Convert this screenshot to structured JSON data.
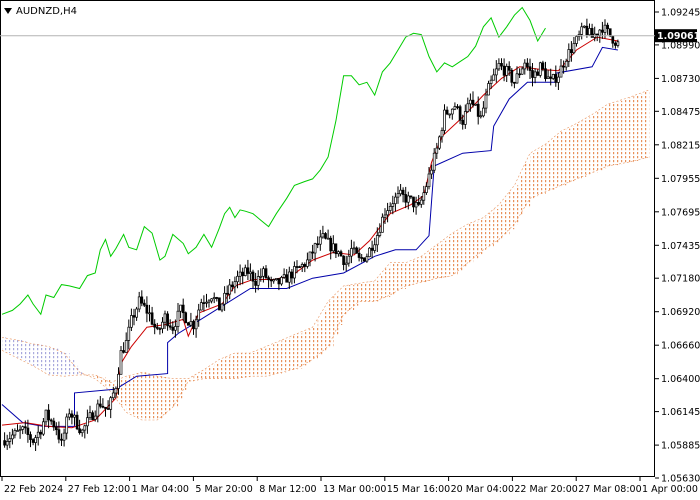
{
  "chart_data": {
    "type": "candlestick",
    "symbol_label": "AUDNZD,H4",
    "current_price": "1.09061",
    "x_tick_labels": [
      "22 Feb 2024",
      "27 Feb 12:00",
      "1 Mar 04:00",
      "5 Mar 20:00",
      "8 Mar 12:00",
      "13 Mar 00:00",
      "15 Mar 16:00",
      "20 Mar 04:00",
      "22 Mar 20:00",
      "27 Mar 08:00",
      "1 Apr 00:00"
    ],
    "y_tick_labels": [
      "1.09245",
      "1.08990",
      "1.08730",
      "1.08475",
      "1.08215",
      "1.07955",
      "1.07695",
      "1.07435",
      "1.07180",
      "1.06920",
      "1.06660",
      "1.06400",
      "1.06145",
      "1.05885",
      "1.05630"
    ],
    "ylim": [
      1.0563,
      1.09245
    ],
    "colors": {
      "candles": "#000000",
      "tenkan": "#cc0000",
      "kijun": "#0000aa",
      "chikou": "#00cc00",
      "cloud": "#e8915a",
      "cloud_bear": "#a8a8dc",
      "price_line": "#b4b4b4",
      "price_box": "#000000"
    },
    "close_path": [
      [
        0,
        1.0592
      ],
      [
        4,
        1.0596
      ],
      [
        8,
        1.06
      ],
      [
        12,
        1.0592
      ],
      [
        15,
        1.0601
      ],
      [
        17,
        1.0612
      ],
      [
        21,
        1.0602
      ],
      [
        23,
        1.0589
      ],
      [
        26,
        1.0615
      ],
      [
        29,
        1.0605
      ],
      [
        31,
        1.0599
      ],
      [
        34,
        1.061
      ],
      [
        38,
        1.0621
      ],
      [
        41,
        1.0615
      ],
      [
        44,
        1.0635
      ],
      [
        46,
        1.066
      ],
      [
        48,
        1.0668
      ],
      [
        50,
        1.0685
      ],
      [
        53,
        1.07
      ],
      [
        57,
        1.069
      ],
      [
        60,
        1.0675
      ],
      [
        63,
        1.0688
      ],
      [
        66,
        1.068
      ],
      [
        69,
        1.0693
      ],
      [
        72,
        1.0685
      ],
      [
        74,
        1.0682
      ],
      [
        77,
        1.07
      ],
      [
        81,
        1.0705
      ],
      [
        84,
        1.0695
      ],
      [
        88,
        1.071
      ],
      [
        91,
        1.0718
      ],
      [
        95,
        1.0723
      ],
      [
        98,
        1.0716
      ],
      [
        101,
        1.0722
      ],
      [
        104,
        1.0713
      ],
      [
        108,
        1.0715
      ],
      [
        111,
        1.072
      ],
      [
        115,
        1.0726
      ],
      [
        118,
        1.0731
      ],
      [
        121,
        1.0742
      ],
      [
        124,
        1.0749
      ],
      [
        127,
        1.0743
      ],
      [
        130,
        1.0738
      ],
      [
        133,
        1.073
      ],
      [
        135,
        1.074
      ],
      [
        138,
        1.0732
      ],
      [
        141,
        1.0736
      ],
      [
        145,
        1.0752
      ],
      [
        148,
        1.077
      ],
      [
        151,
        1.0778
      ],
      [
        154,
        1.0782
      ],
      [
        158,
        1.0778
      ],
      [
        161,
        1.0772
      ],
      [
        164,
        1.079
      ],
      [
        168,
        1.0818
      ],
      [
        171,
        1.0845
      ],
      [
        175,
        1.0852
      ],
      [
        178,
        1.084
      ],
      [
        181,
        1.0855
      ],
      [
        185,
        1.0842
      ],
      [
        188,
        1.0865
      ],
      [
        192,
        1.0883
      ],
      [
        195,
        1.0878
      ],
      [
        198,
        1.087
      ],
      [
        202,
        1.0886
      ],
      [
        205,
        1.0874
      ],
      [
        208,
        1.0882
      ],
      [
        212,
        1.087
      ],
      [
        215,
        1.0876
      ],
      [
        218,
        1.089
      ],
      [
        222,
        1.0902
      ],
      [
        225,
        1.0912
      ],
      [
        228,
        1.0905
      ],
      [
        232,
        1.0913
      ],
      [
        236,
        1.0904
      ],
      [
        238,
        1.09
      ]
    ],
    "tenkan": [
      [
        0,
        1.0604
      ],
      [
        9,
        1.0606
      ],
      [
        18,
        1.0603
      ],
      [
        27,
        1.0602
      ],
      [
        36,
        1.0608
      ],
      [
        44,
        1.0625
      ],
      [
        46,
        1.0652
      ],
      [
        50,
        1.0665
      ],
      [
        56,
        1.068
      ],
      [
        63,
        1.0682
      ],
      [
        70,
        1.0686
      ],
      [
        72,
        1.0673
      ],
      [
        76,
        1.0691
      ],
      [
        85,
        1.0698
      ],
      [
        90,
        1.0712
      ],
      [
        97,
        1.0717
      ],
      [
        105,
        1.0717
      ],
      [
        112,
        1.072
      ],
      [
        120,
        1.0732
      ],
      [
        128,
        1.0738
      ],
      [
        136,
        1.0736
      ],
      [
        142,
        1.0747
      ],
      [
        150,
        1.0768
      ],
      [
        158,
        1.0775
      ],
      [
        163,
        1.0782
      ],
      [
        166,
        1.0808
      ],
      [
        170,
        1.0828
      ],
      [
        178,
        1.0843
      ],
      [
        186,
        1.086
      ],
      [
        193,
        1.0873
      ],
      [
        200,
        1.0882
      ],
      [
        208,
        1.088
      ],
      [
        215,
        1.0879
      ],
      [
        222,
        1.0895
      ],
      [
        230,
        1.0905
      ],
      [
        238,
        1.0902
      ]
    ],
    "kijun": [
      [
        0,
        1.062
      ],
      [
        8,
        1.0606
      ],
      [
        16,
        1.0603
      ],
      [
        28,
        1.0603
      ],
      [
        28,
        1.0629
      ],
      [
        44,
        1.0632
      ],
      [
        52,
        1.0642
      ],
      [
        64,
        1.0644
      ],
      [
        64,
        1.0668
      ],
      [
        68,
        1.0675
      ],
      [
        80,
        1.069
      ],
      [
        96,
        1.071
      ],
      [
        110,
        1.071
      ],
      [
        120,
        1.0718
      ],
      [
        132,
        1.0722
      ],
      [
        144,
        1.0735
      ],
      [
        152,
        1.074
      ],
      [
        160,
        1.074
      ],
      [
        165,
        1.0751
      ],
      [
        167,
        1.0805
      ],
      [
        178,
        1.0815
      ],
      [
        189,
        1.0817
      ],
      [
        190,
        1.0836
      ],
      [
        196,
        1.0857
      ],
      [
        203,
        1.087
      ],
      [
        214,
        1.087
      ],
      [
        214,
        1.0877
      ],
      [
        228,
        1.0882
      ],
      [
        232,
        1.0897
      ],
      [
        238,
        1.0895
      ]
    ],
    "chikou": [
      [
        0,
        1.069
      ],
      [
        4,
        1.0693
      ],
      [
        7,
        1.0698
      ],
      [
        10,
        1.0705
      ],
      [
        12,
        1.0698
      ],
      [
        15,
        1.069
      ],
      [
        17,
        1.0705
      ],
      [
        20,
        1.0703
      ],
      [
        23,
        1.0713
      ],
      [
        26,
        1.0712
      ],
      [
        30,
        1.071
      ],
      [
        33,
        1.072
      ],
      [
        36,
        1.0722
      ],
      [
        38,
        1.074
      ],
      [
        40,
        1.0748
      ],
      [
        42,
        1.0735
      ],
      [
        44,
        1.0741
      ],
      [
        47,
        1.0752
      ],
      [
        49,
        1.0742
      ],
      [
        52,
        1.074
      ],
      [
        55,
        1.0758
      ],
      [
        58,
        1.0753
      ],
      [
        61,
        1.0732
      ],
      [
        63,
        1.0735
      ],
      [
        66,
        1.0752
      ],
      [
        70,
        1.0745
      ],
      [
        72,
        1.0737
      ],
      [
        75,
        1.0742
      ],
      [
        78,
        1.0752
      ],
      [
        81,
        1.0742
      ],
      [
        84,
        1.0757
      ],
      [
        86,
        1.0768
      ],
      [
        88,
        1.0773
      ],
      [
        90,
        1.0765
      ],
      [
        92,
        1.0771
      ],
      [
        94,
        1.077
      ],
      [
        97,
        1.0768
      ],
      [
        100,
        1.0763
      ],
      [
        103,
        1.0758
      ],
      [
        106,
        1.0768
      ],
      [
        110,
        1.078
      ],
      [
        113,
        1.079
      ],
      [
        117,
        1.0793
      ],
      [
        120,
        1.0795
      ],
      [
        123,
        1.0802
      ],
      [
        126,
        1.0812
      ],
      [
        129,
        1.084
      ],
      [
        132,
        1.0875
      ],
      [
        135,
        1.0875
      ],
      [
        138,
        1.0868
      ],
      [
        141,
        1.087
      ],
      [
        144,
        1.086
      ],
      [
        147,
        1.0878
      ],
      [
        150,
        1.0885
      ],
      [
        153,
        1.0895
      ],
      [
        156,
        1.0905
      ],
      [
        159,
        1.0908
      ],
      [
        162,
        1.0907
      ],
      [
        165,
        1.089
      ],
      [
        168,
        1.0878
      ],
      [
        171,
        1.0885
      ],
      [
        174,
        1.0882
      ],
      [
        177,
        1.0886
      ],
      [
        180,
        1.089
      ],
      [
        183,
        1.0898
      ],
      [
        186,
        1.0913
      ],
      [
        189,
        1.092
      ],
      [
        192,
        1.0905
      ],
      [
        195,
        1.0913
      ],
      [
        198,
        1.0922
      ],
      [
        201,
        1.0928
      ],
      [
        204,
        1.0918
      ],
      [
        207,
        1.0902
      ],
      [
        210,
        1.0912
      ]
    ],
    "span_a": [
      [
        0,
        1.0662
      ],
      [
        6,
        1.0656
      ],
      [
        12,
        1.065
      ],
      [
        18,
        1.0643
      ],
      [
        24,
        1.0642
      ],
      [
        30,
        1.0643
      ],
      [
        36,
        1.0643
      ],
      [
        42,
        1.0637
      ],
      [
        48,
        1.0642
      ],
      [
        54,
        1.0645
      ],
      [
        60,
        1.0642
      ],
      [
        66,
        1.064
      ],
      [
        72,
        1.064
      ],
      [
        78,
        1.0647
      ],
      [
        84,
        1.0655
      ],
      [
        90,
        1.066
      ],
      [
        96,
        1.066
      ],
      [
        102,
        1.0665
      ],
      [
        108,
        1.067
      ],
      [
        114,
        1.0675
      ],
      [
        120,
        1.068
      ],
      [
        126,
        1.07
      ],
      [
        132,
        1.0712
      ],
      [
        138,
        1.0714
      ],
      [
        144,
        1.0716
      ],
      [
        150,
        1.073
      ],
      [
        156,
        1.073
      ],
      [
        162,
        1.0735
      ],
      [
        168,
        1.0744
      ],
      [
        174,
        1.0753
      ],
      [
        180,
        1.076
      ],
      [
        186,
        1.0765
      ],
      [
        192,
        1.0775
      ],
      [
        198,
        1.079
      ],
      [
        204,
        1.0815
      ],
      [
        210,
        1.0822
      ],
      [
        216,
        1.0832
      ],
      [
        222,
        1.0838
      ],
      [
        228,
        1.0845
      ],
      [
        234,
        1.0853
      ],
      [
        242,
        1.0858
      ],
      [
        250,
        1.0864
      ]
    ],
    "span_b": [
      [
        0,
        1.0672
      ],
      [
        6,
        1.067
      ],
      [
        12,
        1.0667
      ],
      [
        18,
        1.0665
      ],
      [
        24,
        1.066
      ],
      [
        30,
        1.0645
      ],
      [
        36,
        1.064
      ],
      [
        42,
        1.063
      ],
      [
        48,
        1.0614
      ],
      [
        54,
        1.0608
      ],
      [
        60,
        1.0608
      ],
      [
        66,
        1.0618
      ],
      [
        72,
        1.0638
      ],
      [
        78,
        1.064
      ],
      [
        84,
        1.064
      ],
      [
        90,
        1.064
      ],
      [
        96,
        1.0642
      ],
      [
        102,
        1.0642
      ],
      [
        108,
        1.0645
      ],
      [
        114,
        1.0648
      ],
      [
        120,
        1.0655
      ],
      [
        126,
        1.0665
      ],
      [
        132,
        1.069
      ],
      [
        138,
        1.07
      ],
      [
        144,
        1.07
      ],
      [
        150,
        1.0705
      ],
      [
        156,
        1.0712
      ],
      [
        162,
        1.0715
      ],
      [
        168,
        1.0718
      ],
      [
        174,
        1.072
      ],
      [
        180,
        1.073
      ],
      [
        186,
        1.074
      ],
      [
        192,
        1.0748
      ],
      [
        198,
        1.076
      ],
      [
        204,
        1.078
      ],
      [
        210,
        1.0785
      ],
      [
        216,
        1.079
      ],
      [
        222,
        1.0795
      ],
      [
        228,
        1.08
      ],
      [
        234,
        1.0805
      ],
      [
        242,
        1.0808
      ],
      [
        250,
        1.0812
      ]
    ],
    "grid": false,
    "legend": "none"
  }
}
